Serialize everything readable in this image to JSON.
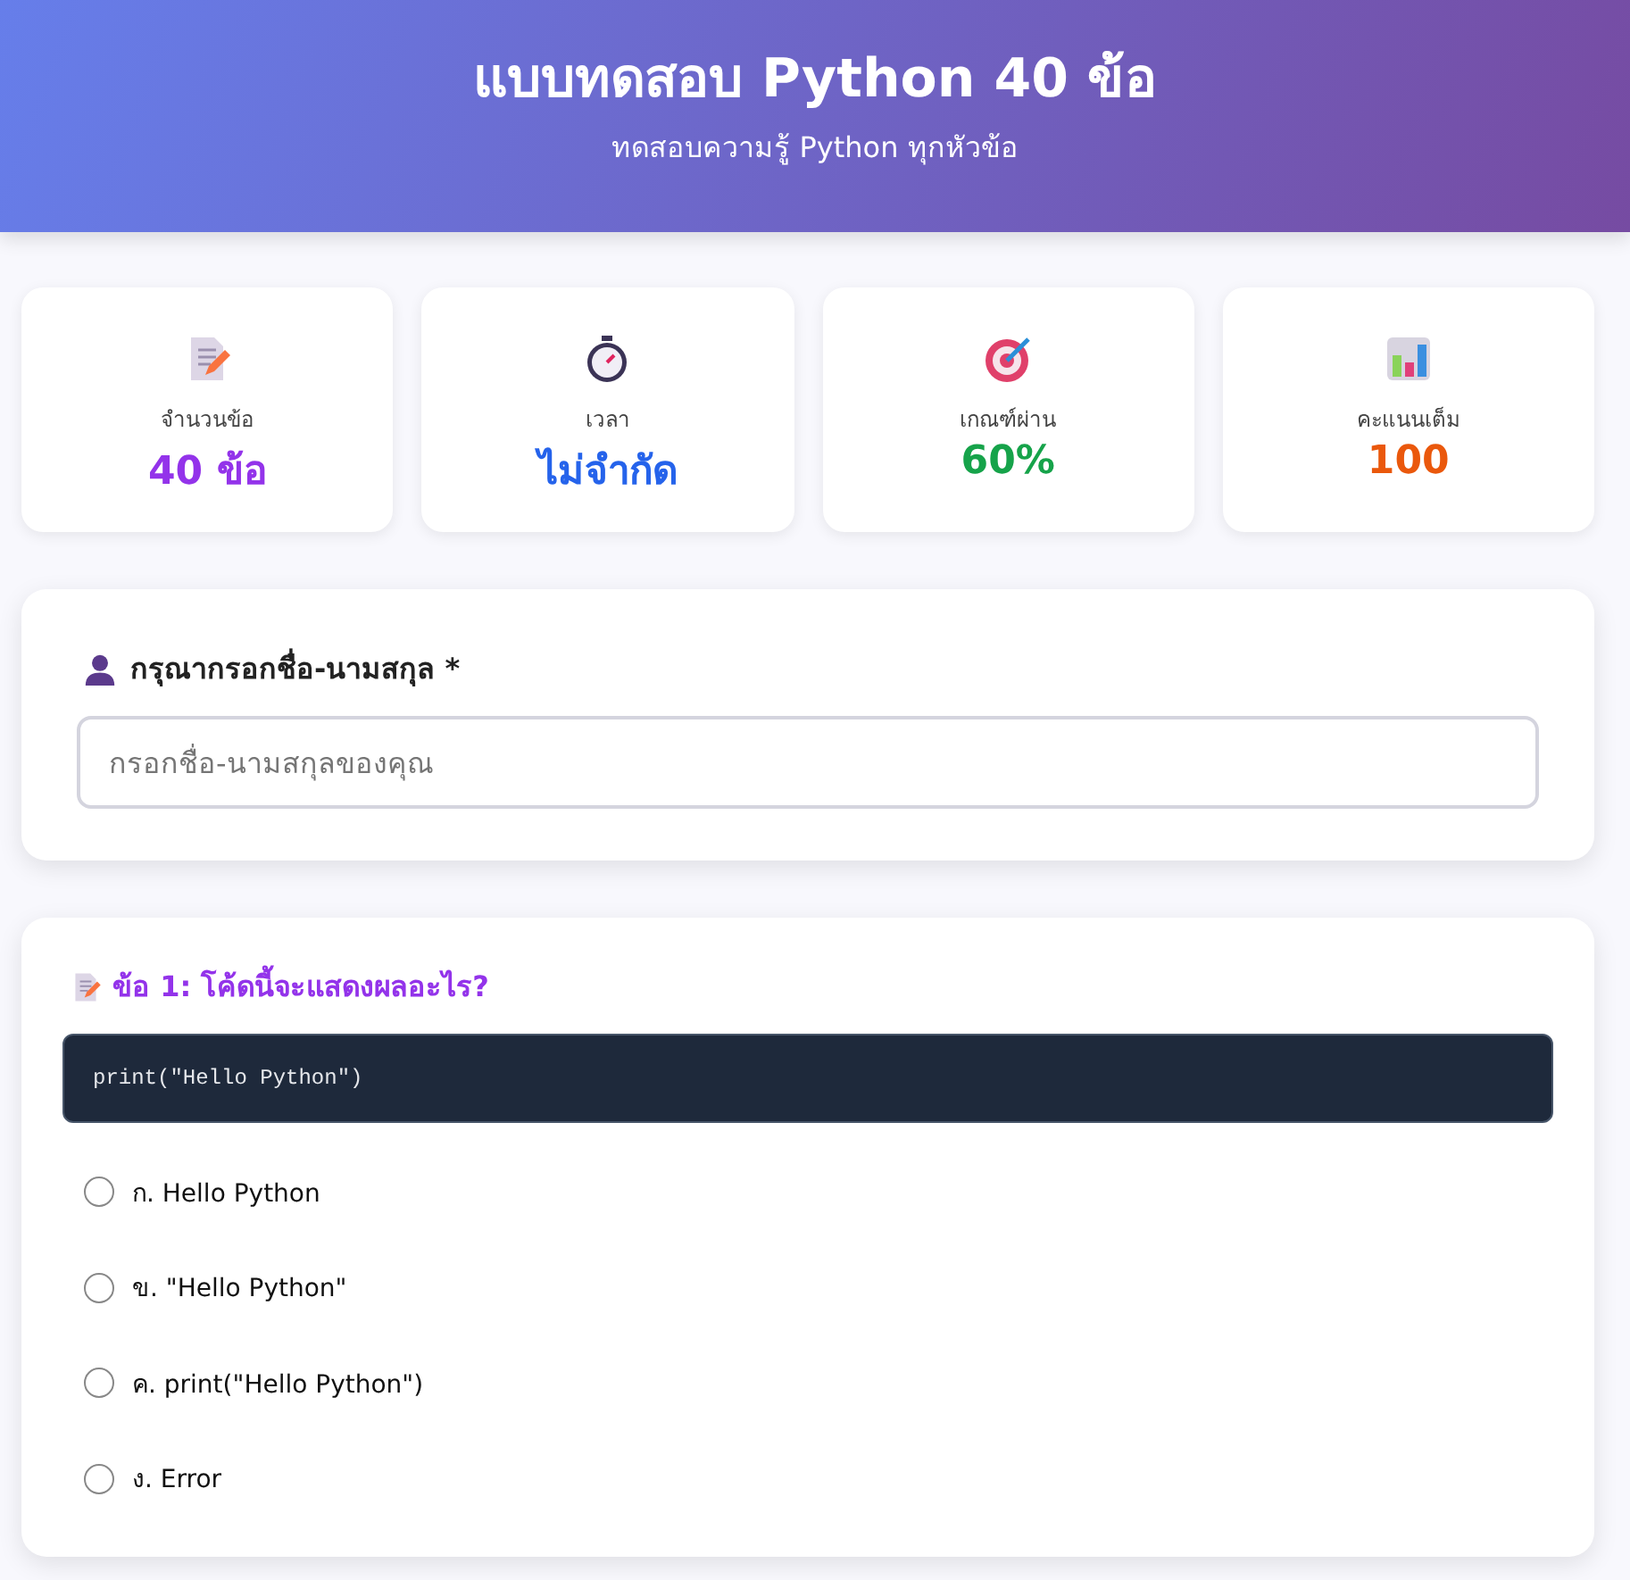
{
  "header": {
    "title": "แบบทดสอบ Python 40 ข้อ",
    "subtitle": "ทดสอบความรู้ Python ทุกหัวข้อ"
  },
  "stats": [
    {
      "kind": "document",
      "label": "จำนวนข้อ",
      "value": "40 ข้อ",
      "color": "#9333ea"
    },
    {
      "kind": "stopwatch",
      "label": "เวลา",
      "value": "ไม่จำกัด",
      "color": "#2563eb"
    },
    {
      "kind": "target",
      "label": "เกณฑ์ผ่าน",
      "value": "60%",
      "color": "#16a34a"
    },
    {
      "kind": "chart",
      "label": "คะแนนเต็ม",
      "value": "100",
      "color": "#ea580c"
    }
  ],
  "name_form": {
    "label": "กรุณากรอกชื่อ-นามสกุล *",
    "placeholder": "กรอกชื่อ-นามสกุลของคุณ"
  },
  "question": {
    "title": "ข้อ 1: โค้ดนี้จะแสดงผลอะไร?",
    "code": "print(\"Hello Python\")",
    "options": [
      {
        "label": "ก. Hello Python",
        "selected": false
      },
      {
        "label": "ข. \"Hello Python\"",
        "selected": false
      },
      {
        "label": "ค. print(\"Hello Python\")",
        "selected": false
      },
      {
        "label": "ง. Error",
        "selected": false
      }
    ]
  }
}
